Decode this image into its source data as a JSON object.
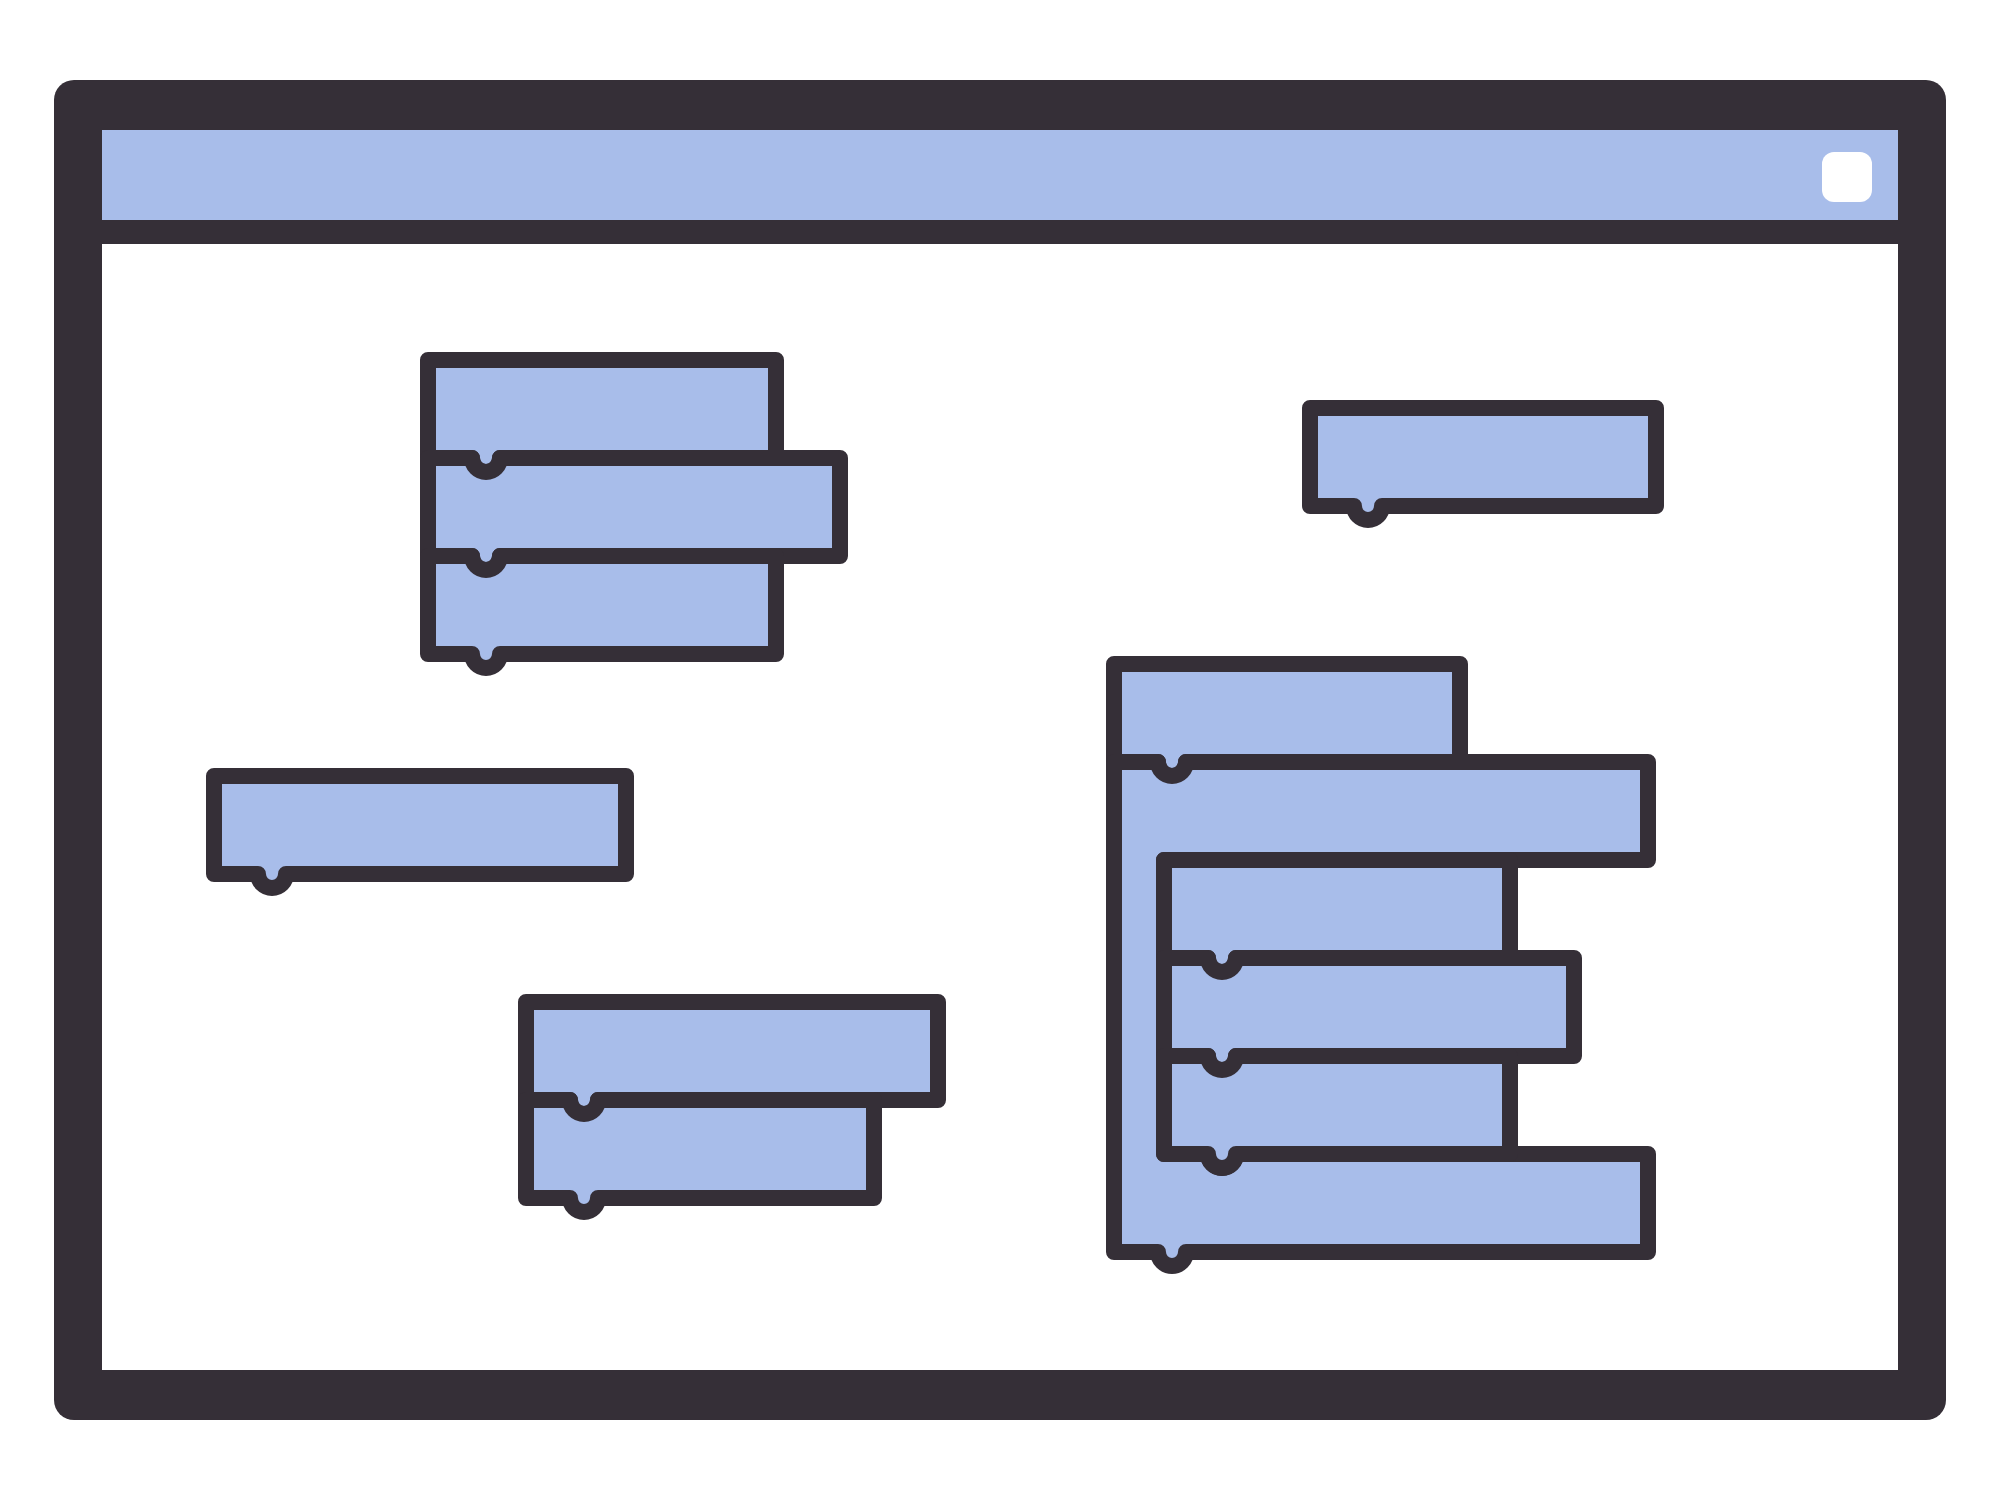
{
  "window": {
    "workspace": {
      "stacks": [
        {
          "blocks": [
            {
              "kind": "command"
            },
            {
              "kind": "command"
            },
            {
              "kind": "command"
            }
          ]
        },
        {
          "blocks": [
            {
              "kind": "command"
            }
          ]
        },
        {
          "blocks": [
            {
              "kind": "command"
            }
          ]
        },
        {
          "blocks": [
            {
              "kind": "command"
            },
            {
              "kind": "command"
            }
          ]
        },
        {
          "blocks": [
            {
              "kind": "command"
            },
            {
              "kind": "c-block",
              "children": [
                {
                  "kind": "command"
                },
                {
                  "kind": "command"
                },
                {
                  "kind": "command"
                }
              ]
            }
          ]
        }
      ]
    }
  }
}
